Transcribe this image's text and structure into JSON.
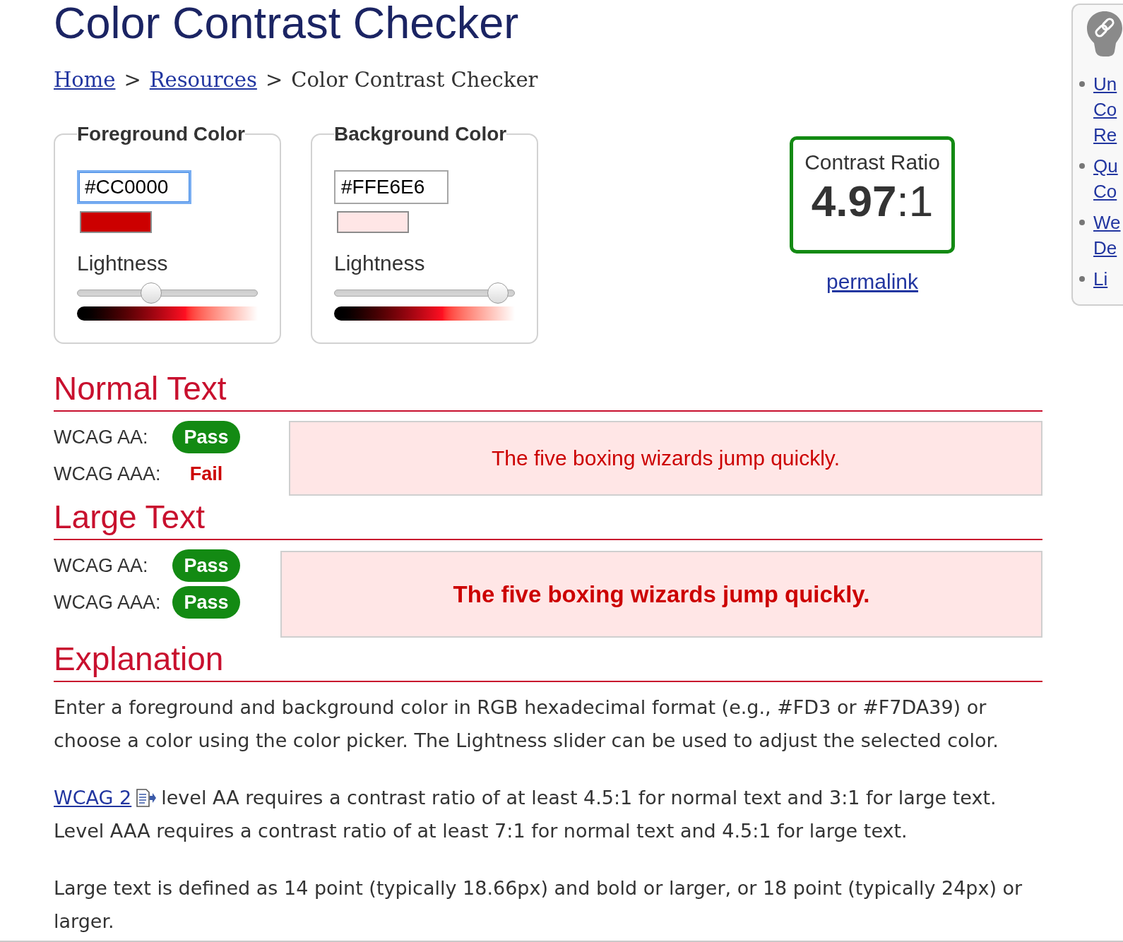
{
  "page": {
    "title": "Color Contrast Checker"
  },
  "breadcrumb": {
    "separator": ">",
    "items": [
      {
        "label": "Home",
        "link": true
      },
      {
        "label": "Resources",
        "link": true
      },
      {
        "label": "Color Contrast Checker",
        "link": false
      }
    ]
  },
  "color_panels": [
    {
      "legend": "Foreground Color",
      "value": "#CC0000",
      "focused": true,
      "color": "#cc0000",
      "slider_label": "Lightness",
      "lightness": {
        "level": 0.4
      }
    },
    {
      "legend": "Background Color",
      "value": "#FFE6E6",
      "focused": false,
      "color": "#ffe6e6",
      "slider_label": "Lightness",
      "lightness": {
        "level": 0.96
      }
    }
  ],
  "contrast": {
    "label": "Contrast Ratio",
    "ratio": "**4.97**:1",
    "link": "permalink"
  },
  "sections": [
    {
      "kind": "normal",
      "heading": "Normal Text",
      "results": [
        {
          "label": "WCAG AA:",
          "result": "Pass",
          "pass": true
        },
        {
          "label": "WCAG AAA:",
          "result": "Fail",
          "pass": false
        }
      ],
      "sample": "The five boxing wizards jump quickly."
    },
    {
      "kind": "large",
      "heading": "Large Text",
      "results": [
        {
          "label": "WCAG AA:",
          "result": "Pass",
          "pass": true
        },
        {
          "label": "WCAG AAA:",
          "result": "Pass",
          "pass": true
        }
      ],
      "sample": "The five boxing wizards jump quickly."
    }
  ],
  "explanation": {
    "heading": "Explanation",
    "paragraphs": [
      {
        "text": "Enter a foreground and background color in RGB hexadecimal format (e.g., #FD3 or #F7DA39) or choose a color using the color picker. The Lightness slider can be used to adjust the selected color."
      },
      {
        "link": "WCAG 2",
        "text": "level AA requires a contrast ratio of at least 4.5:1 for normal text and 3:1 for large text. Level AAA requires a contrast ratio of at least 7:1 for normal text and 4.5:1 for large text."
      },
      {
        "text": "Large text is defined as 14 point (typically 18.66px) and bold or larger, or 18 point (typically 24px) or larger."
      }
    ]
  },
  "sidebar": {
    "items": [
      {
        "lines": [
          "Un",
          "Co",
          "Re"
        ]
      },
      {
        "lines": [
          "Qu",
          "Co"
        ]
      },
      {
        "lines": [
          "We",
          "De"
        ]
      },
      {
        "lines": [
          "Li"
        ]
      }
    ]
  }
}
